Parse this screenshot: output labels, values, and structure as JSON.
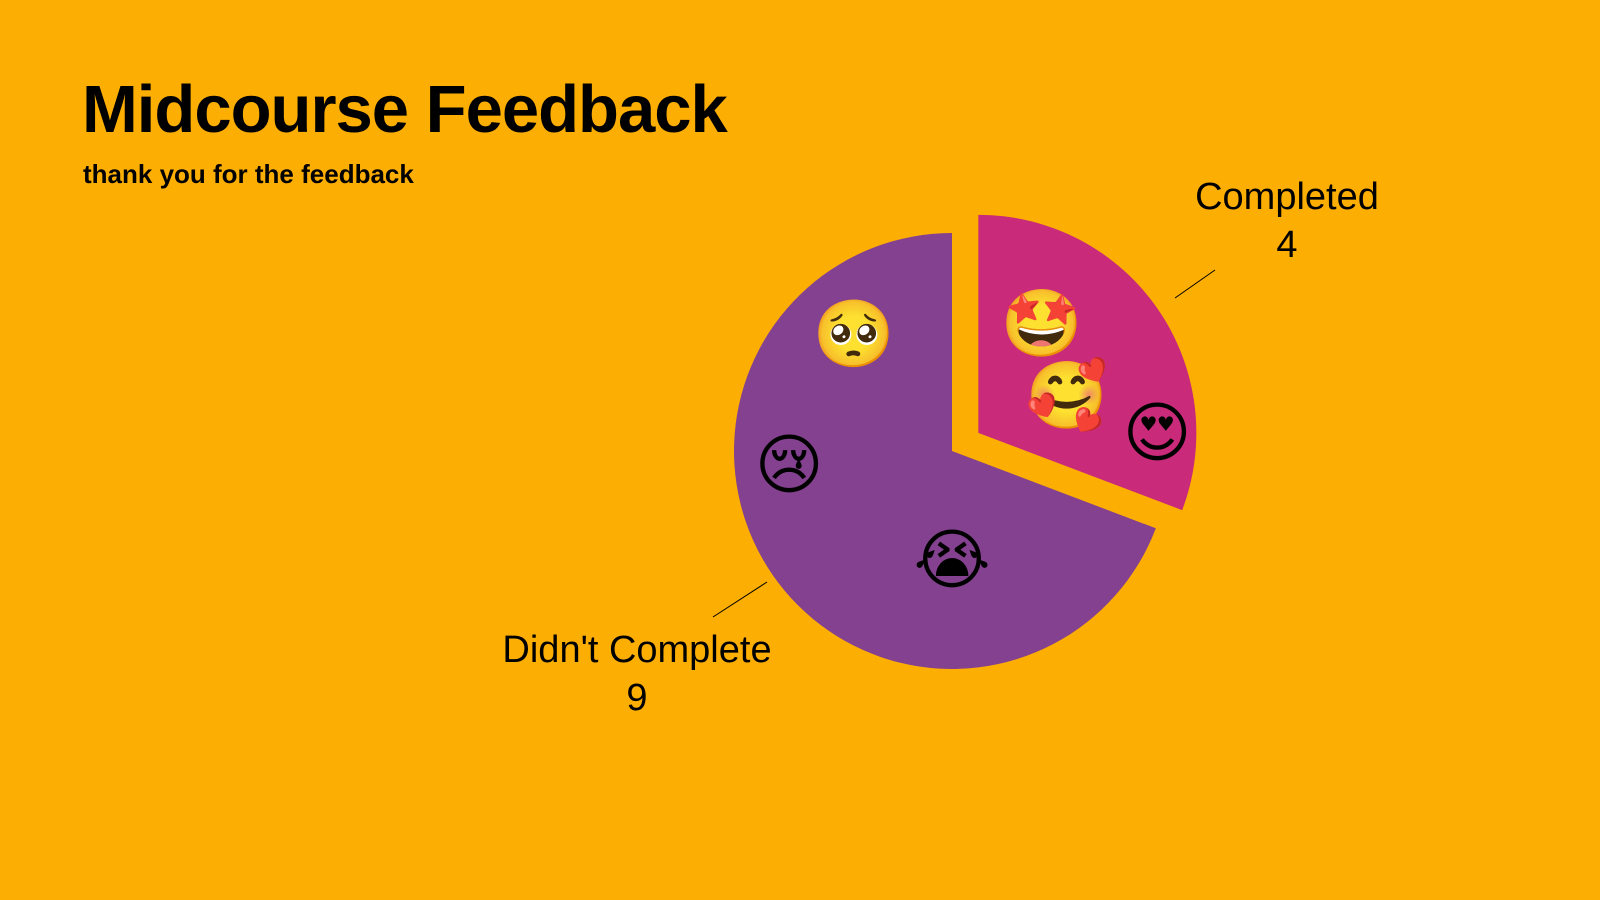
{
  "slide": {
    "title": "Midcourse Feedback",
    "subtitle": "thank you for the feedback",
    "background_color": "#FDAE02"
  },
  "chart_data": {
    "type": "pie",
    "title": "",
    "start_angle_deg": 0,
    "slices": [
      {
        "label": "Completed",
        "value": 4,
        "color": "#C92A7A",
        "exploded": true,
        "emojis": [
          {
            "name": "star-struck-emoji",
            "char": "🤩"
          },
          {
            "name": "smiling-face-with-hearts-emoji",
            "char": "🥰"
          },
          {
            "name": "heart-eyes-emoji",
            "char": "😍"
          }
        ]
      },
      {
        "label": "Didn't Complete",
        "value": 9,
        "color": "#83418F",
        "exploded": false,
        "emojis": [
          {
            "name": "pleading-face-emoji",
            "char": "🥺"
          },
          {
            "name": "crying-face-emoji",
            "char": "😢"
          },
          {
            "name": "loudly-crying-face-emoji",
            "char": "😭"
          }
        ]
      }
    ]
  }
}
